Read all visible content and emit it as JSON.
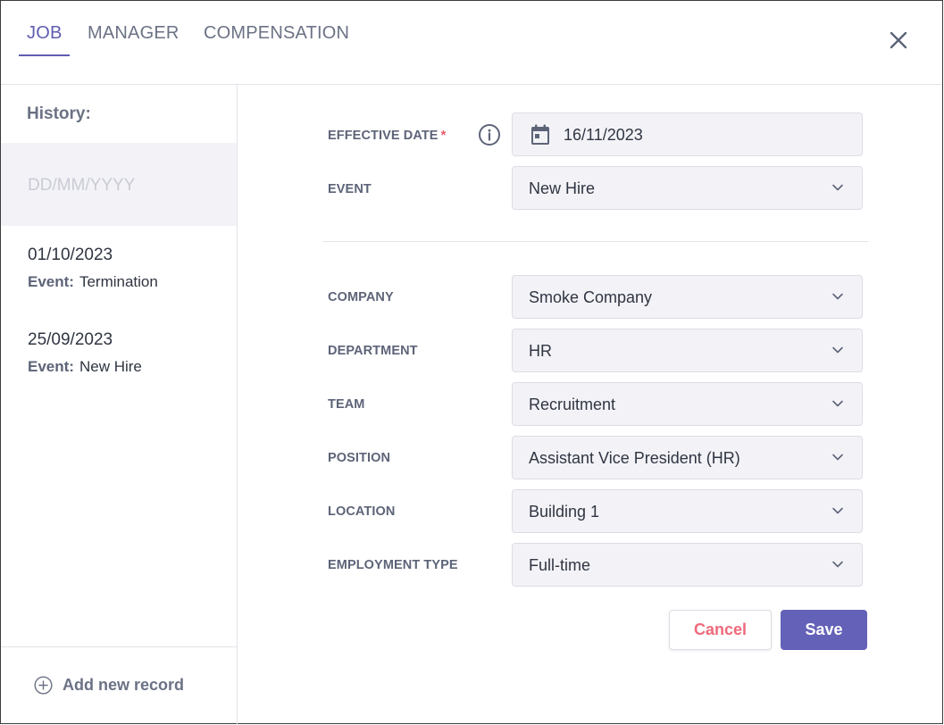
{
  "tabs": [
    {
      "label": "JOB",
      "active": true
    },
    {
      "label": "MANAGER",
      "active": false
    },
    {
      "label": "COMPENSATION",
      "active": false
    }
  ],
  "icons": {
    "close": "close-icon",
    "info": "info-icon",
    "calendar": "calendar-icon",
    "chevron": "chevron-down-icon",
    "add": "plus-circle-icon"
  },
  "sidebar": {
    "title": "History:",
    "new_entry_placeholder": "DD/MM/YYYY",
    "items": [
      {
        "date": "01/10/2023",
        "event_label": "Event:",
        "event_value": "Termination"
      },
      {
        "date": "25/09/2023",
        "event_label": "Event:",
        "event_value": "New Hire"
      }
    ],
    "add_record_label": "Add new record"
  },
  "form": {
    "effective_date": {
      "label": "EFFECTIVE DATE",
      "required_mark": "*",
      "value": "16/11/2023"
    },
    "event": {
      "label": "EVENT",
      "value": "New Hire"
    },
    "company": {
      "label": "COMPANY",
      "value": "Smoke Company"
    },
    "department": {
      "label": "DEPARTMENT",
      "value": "HR"
    },
    "team": {
      "label": "TEAM",
      "value": "Recruitment"
    },
    "position": {
      "label": "POSITION",
      "value": "Assistant Vice President (HR)"
    },
    "location": {
      "label": "LOCATION",
      "value": "Building 1"
    },
    "employment_type": {
      "label": "EMPLOYMENT TYPE",
      "value": "Full-time"
    }
  },
  "actions": {
    "cancel_label": "Cancel",
    "save_label": "Save"
  },
  "colors": {
    "accent": "#5f5db0",
    "save_button": "#6461b8",
    "cancel_text": "#ee6a7b",
    "required": "#e85a6b",
    "field_bg": "#f3f3f7"
  }
}
